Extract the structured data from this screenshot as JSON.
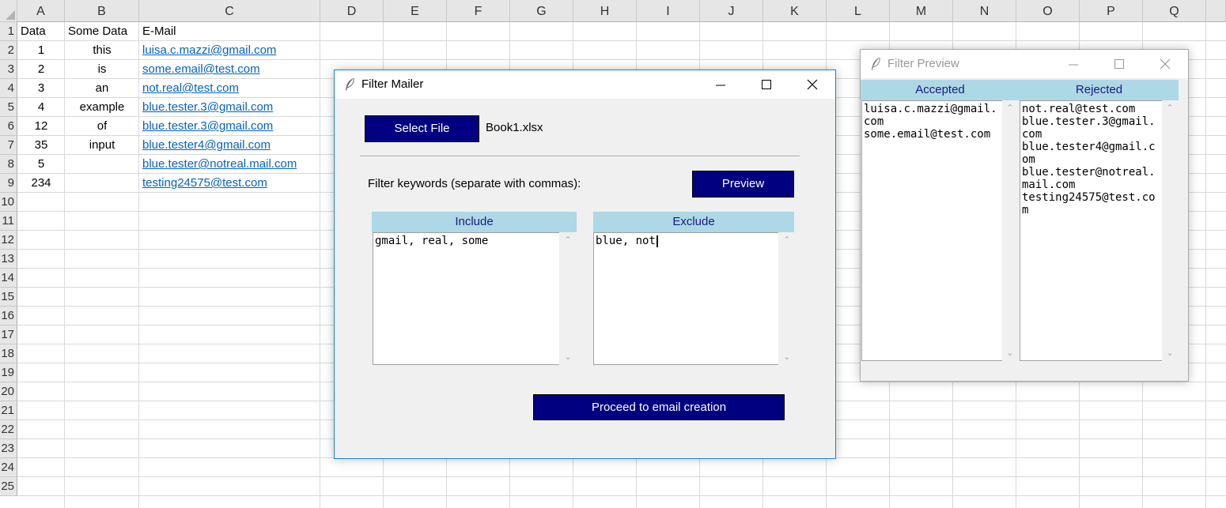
{
  "sheet": {
    "columns": [
      "A",
      "B",
      "C",
      "D",
      "E",
      "F",
      "G",
      "H",
      "I",
      "J",
      "K",
      "L",
      "M",
      "N",
      "O",
      "P",
      "Q"
    ],
    "rows": [
      "1",
      "2",
      "3",
      "4",
      "5",
      "6",
      "7",
      "8",
      "9",
      "10",
      "11",
      "12",
      "13",
      "14",
      "15",
      "16",
      "17",
      "18",
      "19",
      "20",
      "21",
      "22",
      "23",
      "24",
      "25"
    ],
    "cells": [
      [
        "Data",
        "Some Data",
        "E-Mail"
      ],
      [
        "1",
        "this",
        "luisa.c.mazzi@gmail.com"
      ],
      [
        "2",
        "is",
        "some.email@test.com"
      ],
      [
        "3",
        "an",
        "not.real@test.com"
      ],
      [
        "4",
        "example",
        "blue.tester.3@gmail.com"
      ],
      [
        "12",
        "of",
        "blue.tester.3@gmail.com"
      ],
      [
        "35",
        "input",
        "blue.tester4@gmail.com"
      ],
      [
        "5",
        "",
        "blue.tester@notreal.mail.com"
      ],
      [
        "234",
        "",
        "testing24575@test.com"
      ]
    ]
  },
  "filter_mailer": {
    "title": "Filter Mailer",
    "select_file_label": "Select File",
    "file_name": "Book1.xlsx",
    "keywords_label": "Filter keywords (separate with commas):",
    "preview_label": "Preview",
    "include_header": "Include",
    "exclude_header": "Exclude",
    "include_value": "gmail, real, some",
    "exclude_value": "blue, not",
    "proceed_label": "Proceed to email creation"
  },
  "filter_preview": {
    "title": "Filter Preview",
    "accepted_header": "Accepted",
    "rejected_header": "Rejected",
    "accepted_text": "luisa.c.mazzi@gmail.com\nsome.email@test.com",
    "rejected_text": "not.real@test.com\nblue.tester.3@gmail.com\nblue.tester4@gmail.com\nblue.tester@notreal.mail.com\ntesting24575@test.com"
  },
  "icons": {
    "feather": "feather-icon",
    "minimize": "minimize-icon",
    "maximize": "maximize-icon",
    "close": "close-icon",
    "scroll_up": "chevron-up-icon",
    "scroll_down": "chevron-down-icon"
  },
  "colors": {
    "button_navy": "#000080",
    "header_light_blue": "#add8e6",
    "link_blue": "#0563c1",
    "active_border": "#1883d7"
  }
}
